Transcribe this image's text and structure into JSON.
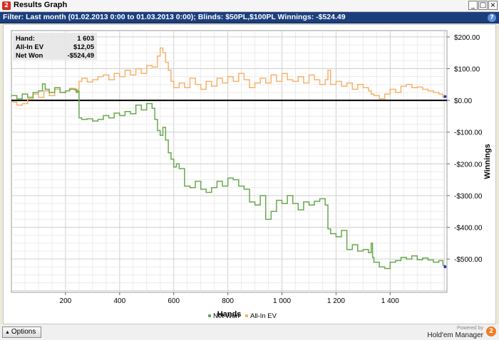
{
  "window": {
    "title": "Results Graph",
    "app_icon": "2",
    "minimize": "_",
    "maximize": "□",
    "close": "×"
  },
  "filter": {
    "text": "Filter: Last month (01.02.2013 0:00 to 01.03.2013 0:00); Blinds: $50PL,$100PL Winnings: -$524.49",
    "help": "?"
  },
  "stats": {
    "rows": [
      {
        "label": "Hand:",
        "value": "1 603"
      },
      {
        "label": "All-In EV",
        "value": "$12,05"
      },
      {
        "label": "Net Won",
        "value": "-$524,49"
      }
    ]
  },
  "bottom": {
    "options_label": "Options",
    "powered_by": "Powered by",
    "brand_name": "Hold'em Manager",
    "brand_logo": "2"
  },
  "chart_data": {
    "type": "line",
    "xlabel": "Hands",
    "ylabel": "Winnings",
    "xlim": [
      0,
      1610
    ],
    "ylim": [
      -605,
      220
    ],
    "x_ticks": [
      200,
      400,
      600,
      800,
      1000,
      1200,
      1400
    ],
    "x_tick_labels": [
      "200",
      "400",
      "600",
      "800",
      "1 000",
      "1 200",
      "1 400"
    ],
    "y_ticks": [
      200,
      100,
      0,
      -100,
      -200,
      -300,
      -400,
      -500
    ],
    "y_tick_labels": [
      "$200.00",
      "$100.00",
      "$0.00",
      "-$100.00",
      "-$200.00",
      "-$300.00",
      "-$400.00",
      "-$500.00"
    ],
    "grid": true,
    "legend": "bottom-center",
    "series": [
      {
        "name": "Net Won",
        "color": "#6aa84f",
        "x": [
          0,
          20,
          40,
          60,
          80,
          100,
          115,
          125,
          140,
          160,
          180,
          200,
          215,
          240,
          245,
          250,
          260,
          280,
          300,
          320,
          340,
          360,
          380,
          400,
          420,
          440,
          460,
          480,
          500,
          520,
          530,
          540,
          550,
          560,
          570,
          580,
          590,
          600,
          610,
          620,
          640,
          660,
          680,
          700,
          720,
          740,
          760,
          780,
          800,
          820,
          840,
          860,
          880,
          900,
          920,
          940,
          960,
          980,
          1000,
          1020,
          1040,
          1060,
          1080,
          1100,
          1120,
          1140,
          1160,
          1170,
          1180,
          1200,
          1220,
          1240,
          1260,
          1280,
          1300,
          1320,
          1330,
          1335,
          1340,
          1360,
          1380,
          1400,
          1420,
          1440,
          1460,
          1480,
          1500,
          1520,
          1540,
          1560,
          1580,
          1595,
          1603
        ],
        "values": [
          15,
          5,
          20,
          10,
          25,
          30,
          52,
          35,
          25,
          40,
          25,
          30,
          35,
          25,
          30,
          -55,
          -60,
          -58,
          -65,
          -60,
          -48,
          -55,
          -40,
          -48,
          -35,
          -42,
          -15,
          -30,
          -10,
          -25,
          -60,
          -95,
          -110,
          -85,
          -125,
          -165,
          -185,
          -210,
          -200,
          -215,
          -270,
          -275,
          -255,
          -280,
          -290,
          -275,
          -255,
          -270,
          -245,
          -250,
          -270,
          -280,
          -320,
          -330,
          -300,
          -375,
          -350,
          -315,
          -325,
          -300,
          -325,
          -345,
          -320,
          -330,
          -318,
          -310,
          -330,
          -405,
          -420,
          -430,
          -410,
          -470,
          -455,
          -475,
          -470,
          -480,
          -450,
          -495,
          -510,
          -525,
          -530,
          -510,
          -505,
          -495,
          -500,
          -490,
          -502,
          -497,
          -503,
          -510,
          -505,
          -520,
          -524.49
        ]
      },
      {
        "name": "All-In EV",
        "color": "#f6b26b",
        "x": [
          0,
          20,
          40,
          60,
          80,
          100,
          120,
          140,
          160,
          180,
          200,
          215,
          235,
          245,
          250,
          260,
          280,
          300,
          320,
          340,
          360,
          380,
          400,
          420,
          440,
          460,
          480,
          500,
          520,
          540,
          550,
          560,
          570,
          580,
          590,
          600,
          620,
          640,
          660,
          680,
          700,
          720,
          740,
          760,
          780,
          800,
          820,
          840,
          860,
          880,
          900,
          920,
          940,
          960,
          980,
          1000,
          1020,
          1040,
          1060,
          1080,
          1100,
          1120,
          1140,
          1160,
          1170,
          1180,
          1200,
          1220,
          1240,
          1260,
          1280,
          1300,
          1320,
          1330,
          1340,
          1360,
          1380,
          1400,
          1420,
          1440,
          1460,
          1480,
          1500,
          1520,
          1540,
          1560,
          1580,
          1595,
          1603
        ],
        "values": [
          -5,
          -15,
          -10,
          5,
          20,
          10,
          30,
          15,
          35,
          25,
          30,
          38,
          30,
          35,
          60,
          70,
          58,
          65,
          75,
          80,
          65,
          85,
          75,
          95,
          80,
          100,
          85,
          110,
          105,
          140,
          165,
          150,
          120,
          95,
          60,
          40,
          55,
          40,
          70,
          50,
          35,
          60,
          45,
          70,
          55,
          75,
          60,
          85,
          65,
          40,
          55,
          70,
          55,
          80,
          60,
          85,
          65,
          60,
          75,
          55,
          80,
          65,
          50,
          65,
          95,
          50,
          60,
          45,
          55,
          35,
          50,
          40,
          30,
          20,
          15,
          5,
          20,
          35,
          25,
          45,
          50,
          40,
          42,
          35,
          30,
          25,
          20,
          10,
          12.05
        ]
      }
    ]
  }
}
